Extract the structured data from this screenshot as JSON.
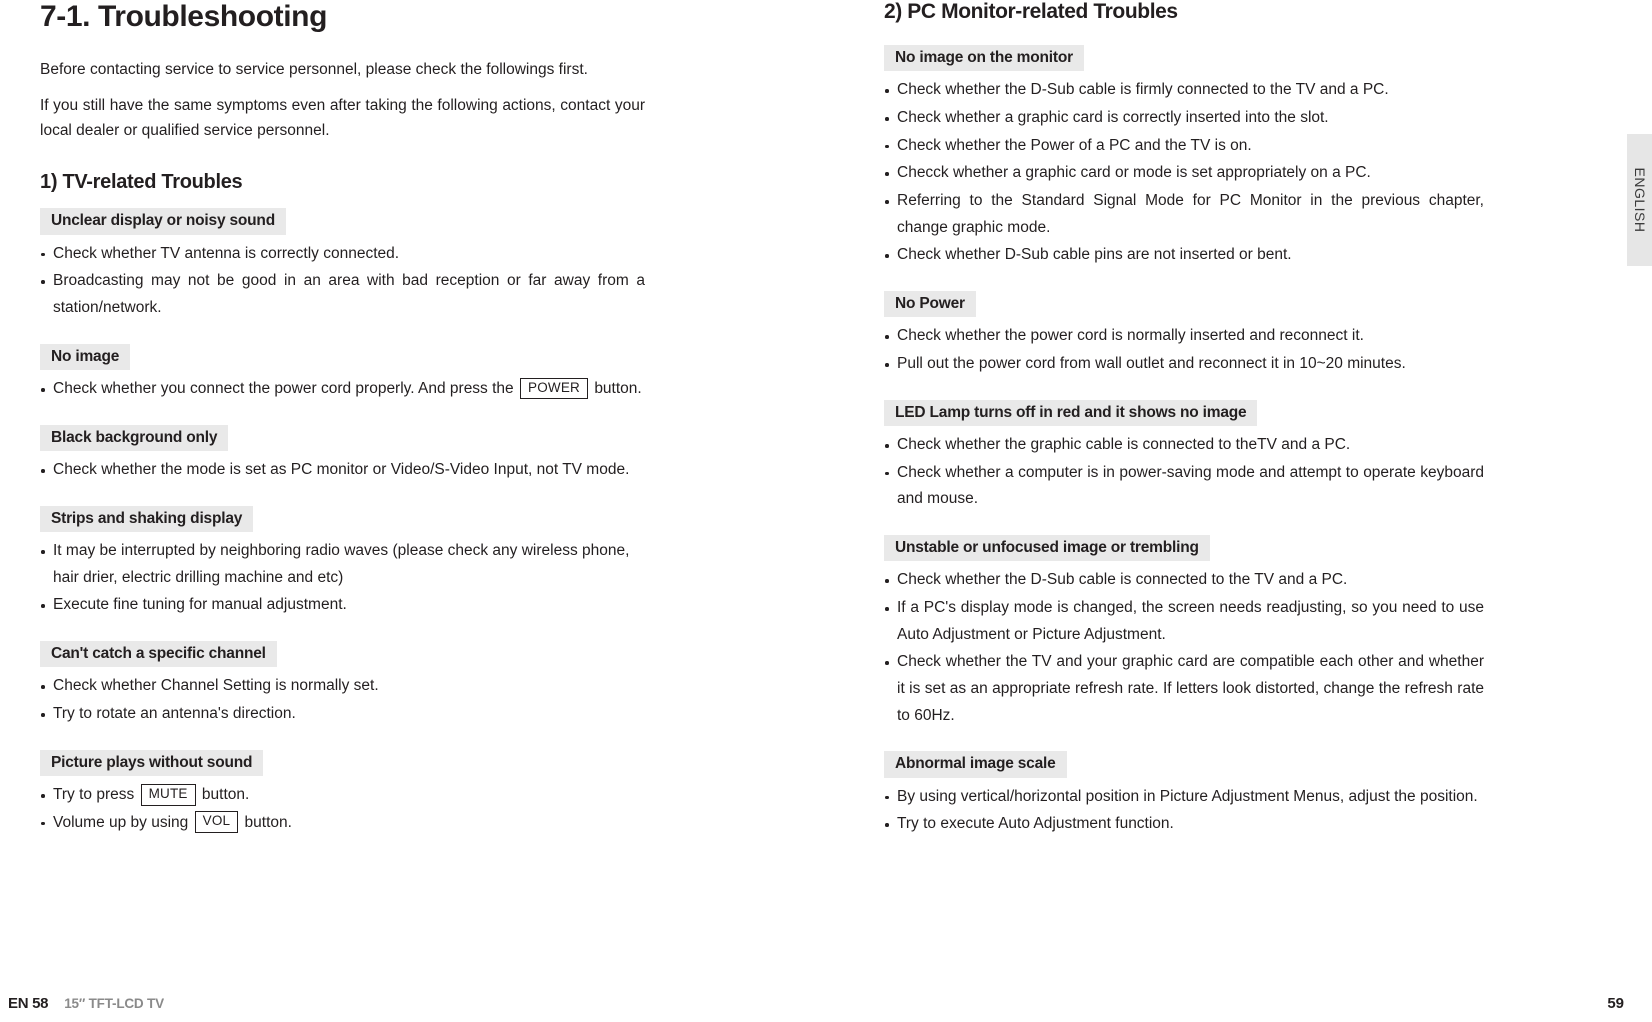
{
  "document": {
    "chapter_title": "7-1. Troubleshooting",
    "intro": [
      "Before contacting service to service personnel, please check the followings first.",
      "If you still have the same symptoms even after taking the following actions, contact your local dealer or qualified service personnel."
    ]
  },
  "left_column": {
    "section_title": "1) TV-related Troubles",
    "blocks": [
      {
        "heading": "Unclear display or noisy sound",
        "items": [
          {
            "text": "Check whether TV antenna is correctly connected."
          },
          {
            "text": "Broadcasting may not be good in an area with bad reception or far away from a station/network."
          }
        ]
      },
      {
        "heading": "No image",
        "items": [
          {
            "before": "Check whether you connect the power cord properly. And press the",
            "key": "POWER",
            "after": "button."
          }
        ]
      },
      {
        "heading": "Black background only",
        "items": [
          {
            "text": "Check whether the mode is set as PC monitor or Video/S-Video Input, not TV mode."
          }
        ]
      },
      {
        "heading": "Strips and shaking display",
        "items": [
          {
            "text": "It may be interrupted by neighboring radio waves (please check any wireless phone, hair drier, electric drilling machine and etc)"
          },
          {
            "text": "Execute fine tuning for manual adjustment."
          }
        ]
      },
      {
        "heading": "Can't catch a specific channel",
        "items": [
          {
            "text": "Check whether Channel Setting is normally set."
          },
          {
            "text": "Try to rotate an antenna's direction."
          }
        ]
      },
      {
        "heading": "Picture plays without sound",
        "items": [
          {
            "before": "Try to press",
            "key": "MUTE",
            "after": "button."
          },
          {
            "before": "Volume up by using",
            "key": "VOL",
            "after": "button."
          }
        ]
      }
    ]
  },
  "right_column": {
    "section_title": "2) PC Monitor-related Troubles",
    "blocks": [
      {
        "heading": "No image on the monitor",
        "items": [
          {
            "text": "Check whether the D-Sub cable is firmly connected to the TV and a PC."
          },
          {
            "text": "Check whether a graphic card is correctly inserted into the slot."
          },
          {
            "text": "Check whether the Power of a PC and the TV is on."
          },
          {
            "text": "Checck whether a graphic card or mode is set appropriately on a PC."
          },
          {
            "text": "Referring to the Standard Signal Mode for PC Monitor in the previous chapter, change graphic mode."
          },
          {
            "text": "Check whether D-Sub cable pins are not inserted or bent."
          }
        ]
      },
      {
        "heading": "No Power",
        "items": [
          {
            "text": "Check whether the power cord is normally inserted and reconnect it."
          },
          {
            "text": "Pull out the power cord from wall outlet and reconnect it in 10~20 minutes."
          }
        ]
      },
      {
        "heading": "LED Lamp turns off in red and it shows no image",
        "items": [
          {
            "text": "Check whether the graphic cable is connected to theTV and a PC."
          },
          {
            "text": "Check whether a computer is in power-saving mode and attempt to operate keyboard and mouse."
          }
        ]
      },
      {
        "heading": "Unstable or unfocused image or trembling",
        "items": [
          {
            "text": "Check whether the D-Sub cable is connected to the TV and a PC."
          },
          {
            "text": "If a PC's display mode is changed, the screen needs readjusting, so you need to use Auto Adjustment or Picture Adjustment."
          },
          {
            "text": "Check whether the TV and your graphic card are compatible each other and whether it is set as an appropriate refresh rate. If letters look distorted, change the refresh rate to 60Hz."
          }
        ]
      },
      {
        "heading": "Abnormal image scale",
        "items": [
          {
            "text": "By using vertical/horizontal position in Picture Adjustment Menus, adjust the position."
          },
          {
            "text": "Try to execute Auto Adjustment function."
          }
        ]
      }
    ]
  },
  "side_tab": {
    "label": "ENGLISH"
  },
  "footer": {
    "left_page": "EN 58",
    "model": "15″ TFT-LCD TV",
    "right_page": "59"
  },
  "colors": {
    "heading_background": "#e9e9e9",
    "text": "#231f20",
    "muted": "#8a8a8a",
    "side_tab_background": "#e6e6e6"
  }
}
